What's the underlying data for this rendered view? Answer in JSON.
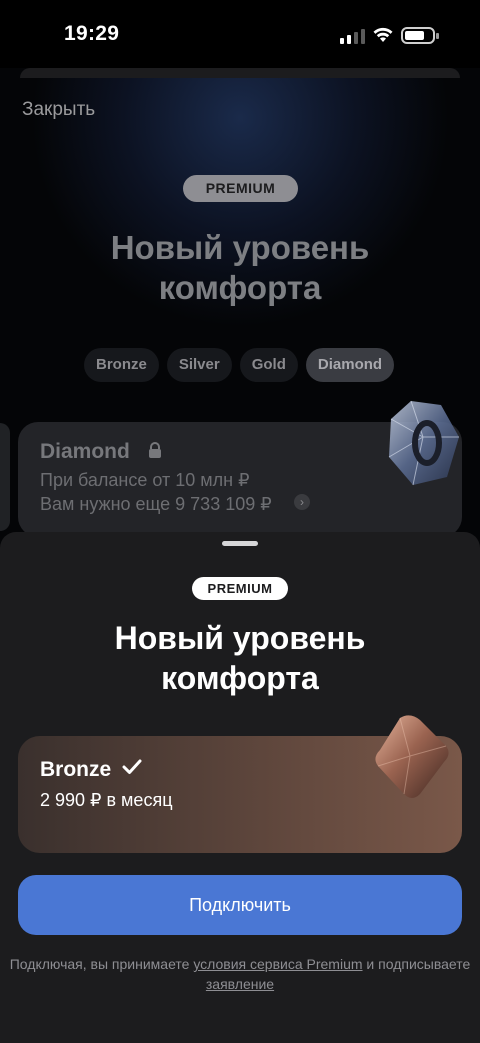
{
  "status_bar": {
    "time": "19:29"
  },
  "background_page": {
    "close_label": "Закрыть",
    "badge": "PREMIUM",
    "title_line1": "Новый уровень",
    "title_line2": "комфорта",
    "tabs": [
      {
        "label": "Bronze"
      },
      {
        "label": "Silver"
      },
      {
        "label": "Gold"
      },
      {
        "label": "Diamond"
      }
    ],
    "card": {
      "title": "Diamond",
      "line1": "При балансе от 10 млн ₽",
      "line2": "Вам нужно еще 9 733 109 ₽",
      "chevron": "›"
    }
  },
  "sheet": {
    "badge": "PREMIUM",
    "title_line1": "Новый уровень",
    "title_line2": "комфорта",
    "plan": {
      "name": "Bronze",
      "price": "2 990 ₽ в месяц"
    },
    "connect_button": "Подключить",
    "terms": {
      "prefix": "Подключая, вы принимаете ",
      "link1": "условия сервиса Premium",
      "middle": " и подписываете ",
      "link2": "заявление"
    }
  },
  "colors": {
    "accent_button": "#4a77d4",
    "sheet_bg": "#1c1c1e",
    "bronze_card": "#5e463c"
  }
}
